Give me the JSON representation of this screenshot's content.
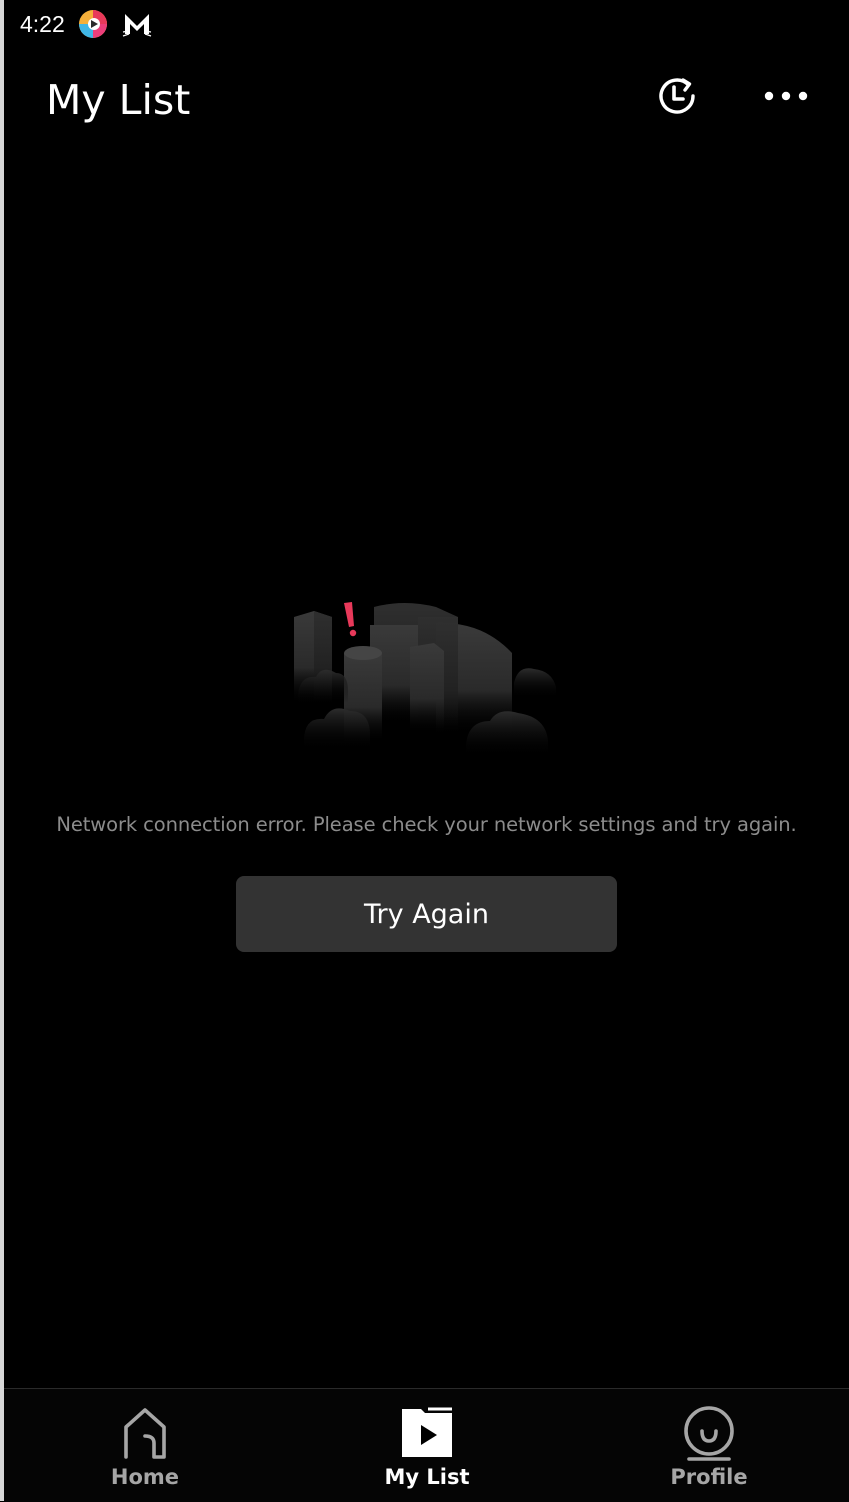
{
  "status_bar": {
    "time": "4:22",
    "icons": [
      "colorful-app-icon",
      "cat-mail-icon"
    ]
  },
  "header": {
    "title": "My List",
    "history_icon": "history-icon",
    "more_icon": "more-icon"
  },
  "empty_state": {
    "illustration": "network-error-illustration",
    "message": "Network connection error. Please check your network settings and try again.",
    "button_label": "Try Again",
    "accent_color": "#e8395a"
  },
  "bottom_nav": {
    "items": [
      {
        "label": "Home",
        "icon": "home-icon",
        "active": false
      },
      {
        "label": "My List",
        "icon": "my-list-icon",
        "active": true
      },
      {
        "label": "Profile",
        "icon": "profile-icon",
        "active": false
      }
    ]
  },
  "colors": {
    "background": "#000000",
    "button_bg": "#333333",
    "message_text": "#8c8c8c",
    "inactive_nav": "#a6a6a6",
    "active_nav": "#ffffff"
  }
}
